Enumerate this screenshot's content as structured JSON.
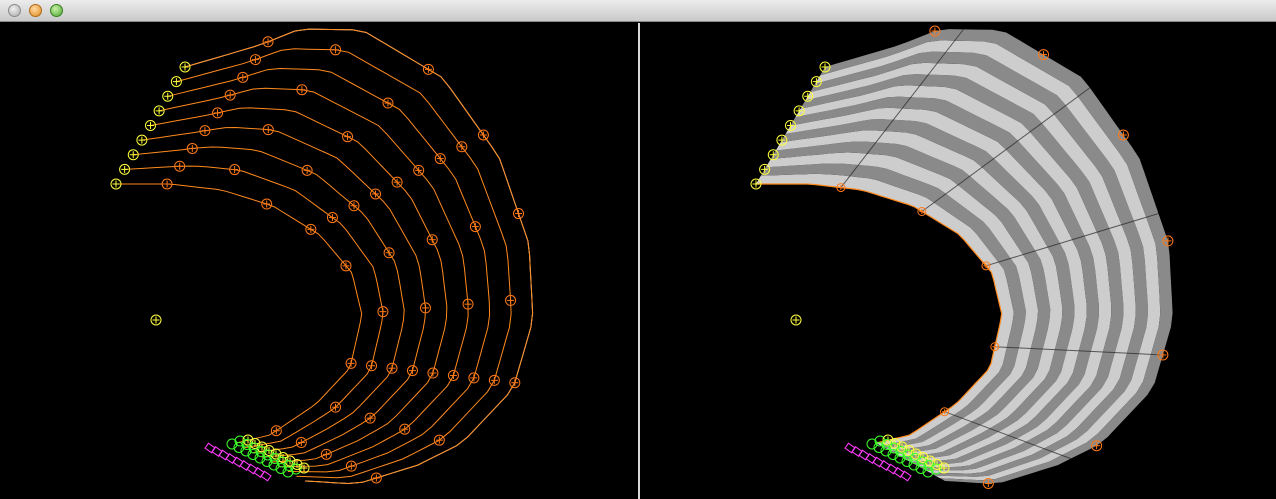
{
  "window": {
    "buttons": [
      "close",
      "minimize",
      "zoom"
    ]
  },
  "viewports": [
    {
      "name": "control-mesh-view",
      "description": "wireframe"
    },
    {
      "name": "shaded-surface-view",
      "description": "shaded"
    }
  ],
  "colors": {
    "background": "#000000",
    "curve": "#ff8a1e",
    "control_point": "#ff7a18",
    "boundary": "#ffffff",
    "handle_yellow": "#ffff3c",
    "handle_green": "#3cff2a",
    "handle_magenta": "#ff3cff",
    "stripe_light": "#cdcdcd",
    "stripe_dark": "#8a8a8a"
  }
}
